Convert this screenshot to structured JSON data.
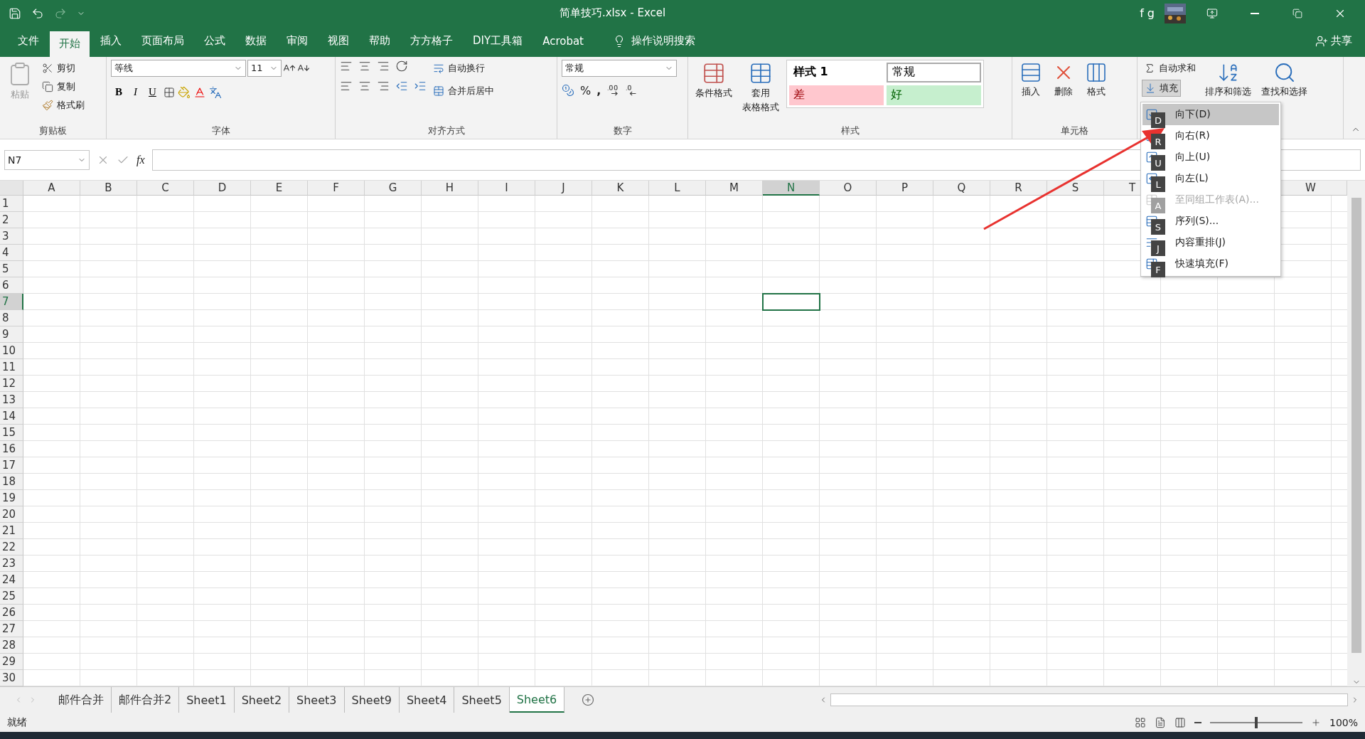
{
  "window": {
    "title": "简单技巧.xlsx  -  Excel",
    "user": "f g"
  },
  "menu_tabs": [
    {
      "label": "文件",
      "selected": false
    },
    {
      "label": "开始",
      "selected": true
    },
    {
      "label": "插入",
      "selected": false
    },
    {
      "label": "页面布局",
      "selected": false
    },
    {
      "label": "公式",
      "selected": false
    },
    {
      "label": "数据",
      "selected": false
    },
    {
      "label": "审阅",
      "selected": false
    },
    {
      "label": "视图",
      "selected": false
    },
    {
      "label": "帮助",
      "selected": false
    },
    {
      "label": "方方格子",
      "selected": false
    },
    {
      "label": "DIY工具箱",
      "selected": false
    },
    {
      "label": "Acrobat",
      "selected": false
    }
  ],
  "tell_me": "操作说明搜索",
  "share": "共享",
  "clipboard": {
    "paste": "粘贴",
    "cut": "剪切",
    "copy": "复制",
    "format_painter": "格式刷",
    "label": "剪贴板"
  },
  "font": {
    "font_name": "等线",
    "font_size": "11",
    "bold": "B",
    "italic": "I",
    "underline": "U",
    "label": "字体"
  },
  "alignment": {
    "wrap": "自动换行",
    "merge": "合并后居中",
    "label": "对齐方式"
  },
  "number": {
    "format": "常规",
    "percent": "%",
    "comma": ",",
    "label": "数字"
  },
  "styles": {
    "conditional": "条件格式",
    "table_format_1": "套用",
    "table_format_2": "表格格式",
    "label": "样式",
    "cells": [
      {
        "label": "样式 1",
        "kind": "heading"
      },
      {
        "label": "常规",
        "kind": "normal"
      },
      {
        "label": "差",
        "kind": "bad"
      },
      {
        "label": "好",
        "kind": "good"
      }
    ]
  },
  "cells": {
    "insert": "插入",
    "delete": "删除",
    "format": "格式",
    "label": "单元格"
  },
  "editing": {
    "autosum": "自动求和",
    "fill": "填充",
    "sort": "排序和筛选",
    "find": "查找和选择"
  },
  "formula_bar": {
    "name_box": "N7",
    "fx": "fx"
  },
  "columns": [
    {
      "label": "A",
      "selected": false
    },
    {
      "label": "B",
      "selected": false
    },
    {
      "label": "C",
      "selected": false
    },
    {
      "label": "D",
      "selected": false
    },
    {
      "label": "E",
      "selected": false
    },
    {
      "label": "F",
      "selected": false
    },
    {
      "label": "G",
      "selected": false
    },
    {
      "label": "H",
      "selected": false
    },
    {
      "label": "I",
      "selected": false
    },
    {
      "label": "J",
      "selected": false
    },
    {
      "label": "K",
      "selected": false
    },
    {
      "label": "L",
      "selected": false
    },
    {
      "label": "M",
      "selected": false
    },
    {
      "label": "N",
      "selected": true
    },
    {
      "label": "O",
      "selected": false
    },
    {
      "label": "P",
      "selected": false
    },
    {
      "label": "Q",
      "selected": false
    },
    {
      "label": "R",
      "selected": false
    },
    {
      "label": "S",
      "selected": false
    },
    {
      "label": "T",
      "selected": false
    },
    {},
    {},
    {
      "label": "W",
      "selected": false
    }
  ],
  "rows": [
    {
      "label": "1",
      "selected": false
    },
    {
      "label": "2",
      "selected": false
    },
    {
      "label": "3",
      "selected": false
    },
    {
      "label": "4",
      "selected": false
    },
    {
      "label": "5",
      "selected": false
    },
    {
      "label": "6",
      "selected": false
    },
    {
      "label": "7",
      "selected": true
    },
    {
      "label": "8",
      "selected": false
    },
    {
      "label": "9",
      "selected": false
    },
    {
      "label": "10",
      "selected": false
    },
    {
      "label": "11",
      "selected": false
    },
    {
      "label": "12",
      "selected": false
    },
    {
      "label": "13",
      "selected": false
    },
    {
      "label": "14",
      "selected": false
    },
    {
      "label": "15",
      "selected": false
    },
    {
      "label": "16",
      "selected": false
    },
    {
      "label": "17",
      "selected": false
    },
    {
      "label": "18",
      "selected": false
    },
    {
      "label": "19",
      "selected": false
    },
    {
      "label": "20",
      "selected": false
    },
    {
      "label": "21",
      "selected": false
    },
    {
      "label": "22",
      "selected": false
    },
    {
      "label": "23",
      "selected": false
    },
    {
      "label": "24",
      "selected": false
    },
    {
      "label": "25",
      "selected": false
    },
    {
      "label": "26",
      "selected": false
    },
    {
      "label": "27",
      "selected": false
    },
    {
      "label": "28",
      "selected": false
    },
    {
      "label": "29",
      "selected": false
    },
    {
      "label": "30",
      "selected": false
    }
  ],
  "fill_menu": [
    {
      "label": "向下(D)",
      "key": "D",
      "selected": true,
      "disabled": false
    },
    {
      "label": "向右(R)",
      "key": "R",
      "selected": false,
      "disabled": false
    },
    {
      "label": "向上(U)",
      "key": "U",
      "selected": false,
      "disabled": false
    },
    {
      "label": "向左(L)",
      "key": "L",
      "selected": false,
      "disabled": false
    },
    {
      "label": "至同组工作表(A)...",
      "key": "A",
      "selected": false,
      "disabled": true
    },
    {
      "label": "序列(S)...",
      "key": "S",
      "selected": false,
      "disabled": false
    },
    {
      "label": "内容重排(J)",
      "key": "J",
      "selected": false,
      "disabled": false
    },
    {
      "label": "快速填充(F)",
      "key": "F",
      "selected": false,
      "disabled": false
    }
  ],
  "sheet_tabs": [
    {
      "label": "邮件合并",
      "selected": false
    },
    {
      "label": "邮件合并2",
      "selected": false
    },
    {
      "label": "Sheet1",
      "selected": false
    },
    {
      "label": "Sheet2",
      "selected": false
    },
    {
      "label": "Sheet3",
      "selected": false
    },
    {
      "label": "Sheet9",
      "selected": false
    },
    {
      "label": "Sheet4",
      "selected": false
    },
    {
      "label": "Sheet5",
      "selected": false
    },
    {
      "label": "Sheet6",
      "selected": true
    }
  ],
  "status_bar": {
    "status": "就绪",
    "zoom": "100%",
    "level": 0.5
  }
}
